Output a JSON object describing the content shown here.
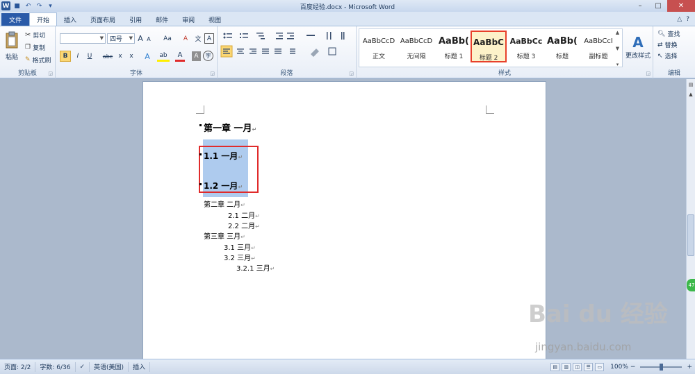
{
  "window": {
    "title": "百度经验.docx - Microsoft Word",
    "minimize": "–",
    "maximize": "□",
    "close": "✕"
  },
  "qat": {
    "app_icon": "W",
    "save": "■",
    "undo": "↶",
    "redo": "↷",
    "customize": "▾"
  },
  "tabs": [
    "文件",
    "开始",
    "插入",
    "页面布局",
    "引用",
    "邮件",
    "审阅",
    "视图"
  ],
  "tab_right": {
    "minimize_ribbon": "△",
    "help": "?"
  },
  "ribbon": {
    "clipboard": {
      "label": "剪贴板",
      "paste": "粘贴",
      "cut": "剪切",
      "copy": "复制",
      "format_painter": "格式刷"
    },
    "font": {
      "label": "字体",
      "font_name": "",
      "font_size": "四号",
      "grow": "A",
      "shrink": "A",
      "case": "Aa",
      "clear": "A",
      "phonetic": "文",
      "border_char": "A",
      "bold": "B",
      "italic": "I",
      "underline": "U",
      "strike": "abc",
      "subscript": "x",
      "superscript": "x",
      "text_effect": "A",
      "highlight": "ab",
      "font_color": "A",
      "shading": "A",
      "enclose": "字"
    },
    "paragraph": {
      "label": "段落"
    },
    "styles": {
      "label": "样式",
      "change_styles": "更改样式",
      "items": [
        {
          "sample": "AaBbCcD",
          "name": "正文",
          "selected": false
        },
        {
          "sample": "AaBbCcD",
          "name": "无间隔",
          "selected": false
        },
        {
          "sample": "AaBb(",
          "name": "标题 1",
          "selected": false
        },
        {
          "sample": "AaBbC",
          "name": "标题 2",
          "selected": true
        },
        {
          "sample": "AaBbCc",
          "name": "标题 3",
          "selected": false
        },
        {
          "sample": "AaBb(",
          "name": "标题",
          "selected": false
        },
        {
          "sample": "AaBbCcI",
          "name": "副标题",
          "selected": false
        }
      ]
    },
    "editing": {
      "label": "编辑",
      "find": "查找",
      "replace": "替换",
      "select": "选择"
    }
  },
  "document": {
    "lines": [
      {
        "text": "第一章  一月",
        "style": "h1"
      },
      {
        "text": "1.1  一月",
        "style": "h2-selected"
      },
      {
        "text": "1.2  一月",
        "style": "h2-selected"
      },
      {
        "text": "第二章  二月",
        "style": "body"
      },
      {
        "text": "2.1  二月",
        "style": "body"
      },
      {
        "text": "2.2  二月",
        "style": "body"
      },
      {
        "text": "第三章  三月",
        "style": "body"
      },
      {
        "text": "3.1  三月",
        "style": "body"
      },
      {
        "text": "3.2  三月",
        "style": "body"
      },
      {
        "text": "3.2.1  三月",
        "style": "body"
      }
    ],
    "para_mark": "↵"
  },
  "statusbar": {
    "page": "页面: 2/2",
    "words": "字数: 6/36",
    "language": "英语(美国)",
    "insert_mode": "插入",
    "zoom": "100%"
  },
  "watermark": {
    "brand": "Bai du 经验",
    "url": "jingyan.baidu.com"
  },
  "side_badge": "47",
  "colors": {
    "accent_file_tab": "#2a5aa8",
    "selection": "#aecbee",
    "highlight_box": "#e02b2b"
  }
}
